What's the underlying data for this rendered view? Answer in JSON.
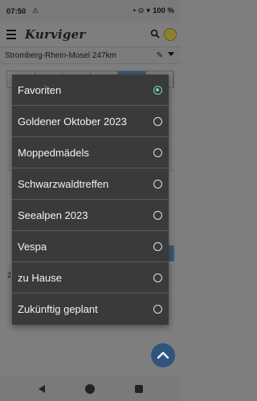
{
  "status_bar": {
    "time": "07:50",
    "left_icons": "⚠",
    "right_icons": "• ⊖ ▾",
    "battery": "100 %"
  },
  "app_bar": {
    "logo": "Kurviger"
  },
  "route": {
    "name": "Stromberg-Rhein-Mosel 247km"
  },
  "background": {
    "marker": "2"
  },
  "popup": {
    "items": [
      {
        "label": "Favoriten",
        "checked": true
      },
      {
        "label": "Goldener Oktober 2023",
        "checked": false
      },
      {
        "label": "Moppedmädels",
        "checked": false
      },
      {
        "label": "Schwarzwaldtreffen",
        "checked": false
      },
      {
        "label": "Seealpen 2023",
        "checked": false
      },
      {
        "label": "Vespa",
        "checked": false
      },
      {
        "label": "zu Hause",
        "checked": false
      },
      {
        "label": "Zukünftig geplant",
        "checked": false
      }
    ]
  },
  "colors": {
    "accent": "#7fd4bb",
    "primary": "#2f557f",
    "popup_bg": "#3a3a3a"
  }
}
